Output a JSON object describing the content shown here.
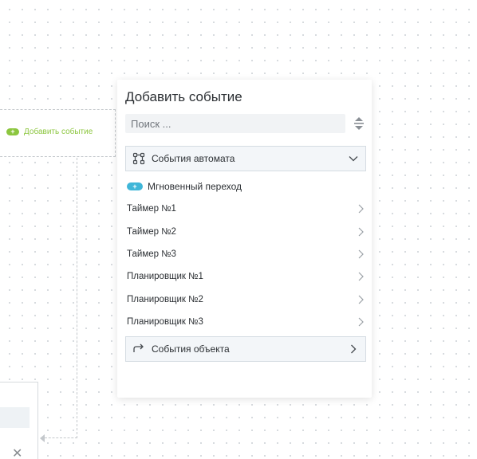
{
  "node": {
    "add_event_label": "Добавить событие",
    "add_badge": "+"
  },
  "popup": {
    "title": "Добавить событие",
    "search": {
      "placeholder": "Поиск ...",
      "value": ""
    },
    "automaton_group": {
      "label": "События автомата",
      "state": "expanded"
    },
    "instant_transition": {
      "badge": "+",
      "label": "Мгновенный переход"
    },
    "events": [
      {
        "label": "Таймер №1"
      },
      {
        "label": "Таймер №2"
      },
      {
        "label": "Таймер №3"
      },
      {
        "label": "Планировщик №1"
      },
      {
        "label": "Планировщик №2"
      },
      {
        "label": "Планировщик №3"
      }
    ],
    "object_group": {
      "label": "События объекта",
      "state": "collapsed"
    }
  },
  "bottom_panel": {
    "close_glyph": "✕"
  },
  "colors": {
    "accent_green": "#8cc63f",
    "accent_blue": "#3fb6d8",
    "text": "#2b2f33",
    "border": "#d5dce2"
  },
  "icons": {
    "sort": "sort-icon",
    "automaton": "state-graph-icon",
    "object": "redirect-arrow-icon",
    "chevron_down": "chevron-down-icon",
    "chevron_right": "chevron-right-icon",
    "close": "close-icon"
  }
}
